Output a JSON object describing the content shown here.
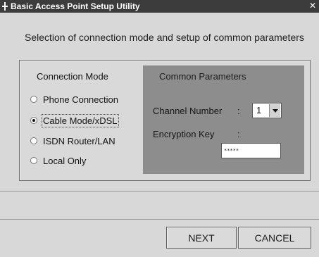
{
  "window": {
    "title": "Basic Access Point Setup Utility",
    "close_glyph": "✕"
  },
  "subtitle": "Selection of connection mode and setup of common parameters",
  "connection_mode": {
    "title": "Connection Mode",
    "options": [
      {
        "label": "Phone Connection",
        "checked": false
      },
      {
        "label": "Cable Mode/xDSL",
        "checked": true
      },
      {
        "label": "ISDN Router/LAN",
        "checked": false
      },
      {
        "label": "Local Only",
        "checked": false
      }
    ]
  },
  "common_parameters": {
    "title": "Common Parameters",
    "channel_label": "Channel Number",
    "channel_colon": ":",
    "channel_value": "1",
    "encryption_label": "Encryption Key",
    "encryption_colon": ":",
    "encryption_value": "*****"
  },
  "buttons": {
    "next": "NEXT",
    "cancel": "CANCEL"
  }
}
